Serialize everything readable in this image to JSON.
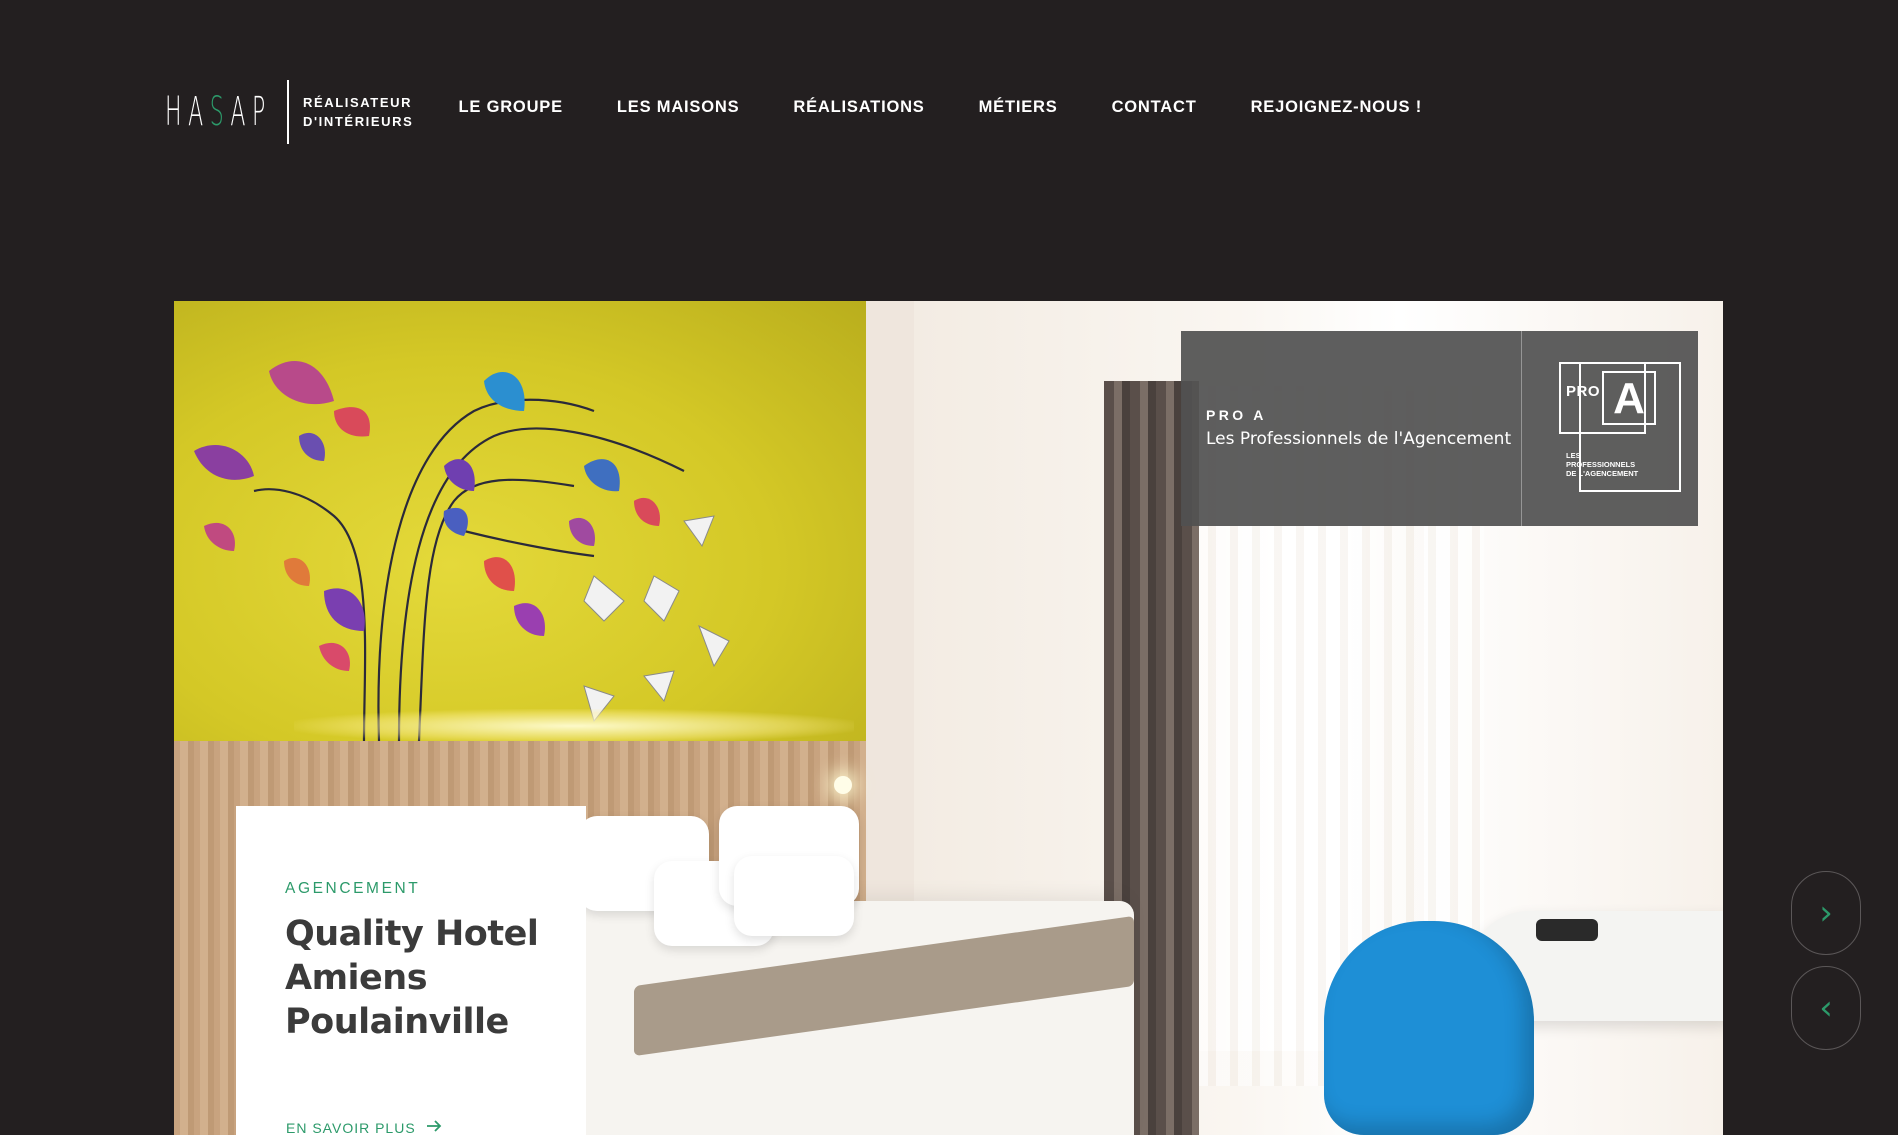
{
  "brand": {
    "logo_letters": [
      "H",
      "A",
      "S",
      "A",
      "P"
    ],
    "tagline_line1": "RÉALISATEUR",
    "tagline_line2": "D'INTÉRIEURS",
    "accent_color": "#2c9a6a",
    "background_color": "#231f20"
  },
  "nav": {
    "items": [
      {
        "label": "LE GROUPE"
      },
      {
        "label": "LES MAISONS"
      },
      {
        "label": "RÉALISATIONS"
      },
      {
        "label": "MÉTIERS"
      },
      {
        "label": "CONTACT"
      },
      {
        "label": "REJOIGNEZ-NOUS !"
      }
    ]
  },
  "hero": {
    "image": "hotel-bedroom-photo",
    "badge": {
      "kicker": "PRO A",
      "title": "Les Professionnels de l'Agencement",
      "logo": {
        "pro": "PRO",
        "a": "A",
        "line1": "LES",
        "line2": "PROFESSIONNELS",
        "line3": "DE L'AGENCEMENT"
      }
    },
    "card": {
      "category": "AGENCEMENT",
      "title_line1": "Quality Hotel",
      "title_line2": "Amiens",
      "title_line3": "Poulainville",
      "link_label": "EN SAVOIR PLUS",
      "link_icon": "arrow-right-icon"
    }
  },
  "slider": {
    "next_icon": "chevron-right-icon",
    "prev_icon": "chevron-left-icon",
    "next_glyph": "›",
    "prev_glyph": "‹"
  }
}
